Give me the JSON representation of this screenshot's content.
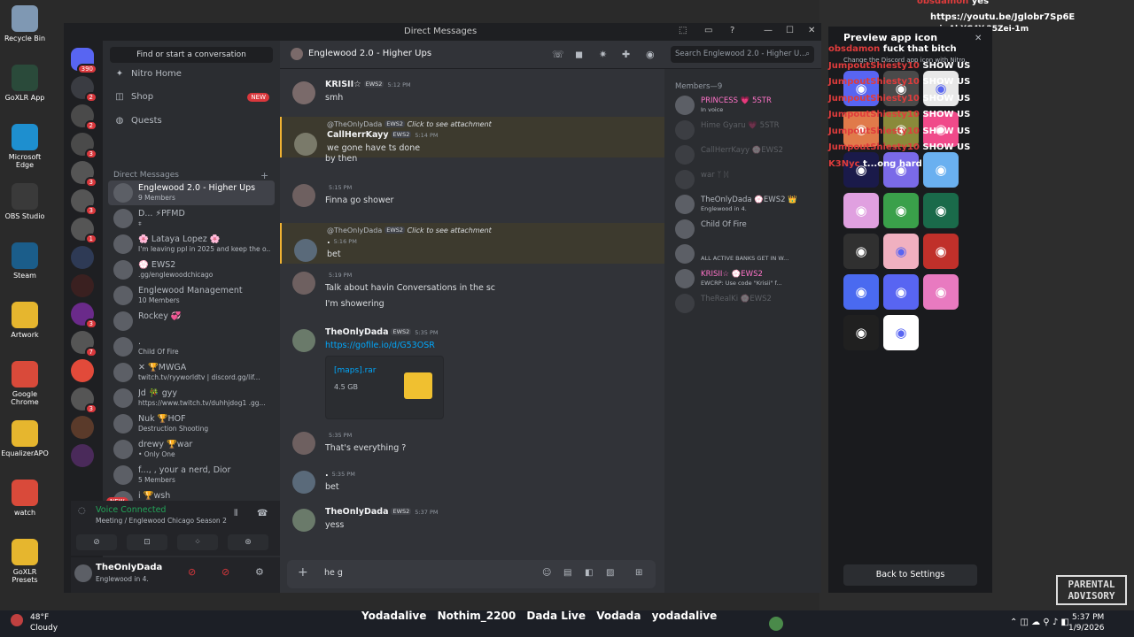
{
  "desktop": {
    "icons": [
      {
        "label": "Recycle Bin",
        "color": "#7f98b3"
      },
      {
        "label": "GoXLR App",
        "color": "#2a4a3a"
      },
      {
        "label": "Microsoft Edge",
        "color": "#1e8fcf"
      },
      {
        "label": "OBS Studio",
        "color": "#3a3a3a"
      },
      {
        "label": "Steam",
        "color": "#1b5d8a"
      },
      {
        "label": "Artwork",
        "color": "#e6b62e"
      },
      {
        "label": "Google Chrome",
        "color": "#d94a3a"
      },
      {
        "label": "EqualizerAPO",
        "color": "#e6b62e"
      },
      {
        "label": "watch",
        "color": "#d94a3a"
      },
      {
        "label": "GoXLR Presets",
        "color": "#e6b62e"
      }
    ],
    "parental_advisory": "PARENTAL ADVISORY"
  },
  "window": {
    "title": "Direct Messages",
    "controls": [
      "⬚",
      "▭",
      "?",
      "—",
      "☐",
      "✕"
    ]
  },
  "guilds": [
    {
      "badge": "390",
      "color": "#5865f2"
    },
    {
      "badge": "2",
      "color": "#3a3c42"
    },
    {
      "badge": "2",
      "color": "#4a4a4a"
    },
    {
      "badge": "3",
      "color": "#4a4a4a"
    },
    {
      "badge": "3",
      "color": "#555"
    },
    {
      "badge": "3",
      "color": "#555"
    },
    {
      "badge": "1",
      "color": "#555"
    },
    {
      "badge": "",
      "color": "#2e3a55"
    },
    {
      "badge": "",
      "color": "#3a2020"
    },
    {
      "badge": "3",
      "color": "#6a2a8a"
    },
    {
      "badge": "7",
      "color": "#555"
    },
    {
      "badge": "",
      "color": "#e24a3a"
    },
    {
      "badge": "3",
      "color": "#555"
    },
    {
      "badge": "",
      "color": "#5a3a2a"
    },
    {
      "badge": "",
      "color": "#4a2a5a"
    }
  ],
  "dm_column": {
    "search_placeholder": "Find or start a conversation",
    "nav": [
      {
        "label": "Nitro Home",
        "icon": "✦"
      },
      {
        "label": "Shop",
        "icon": "◫",
        "new": "NEW"
      },
      {
        "label": "Quests",
        "icon": "◍"
      }
    ],
    "header": "Direct Messages",
    "plus": "+",
    "dms": [
      {
        "name": "Englewood 2.0 - Higher Ups",
        "sub": "9 Members",
        "selected": true
      },
      {
        "name": "D... ⚡PFMD",
        "sub": "⧧"
      },
      {
        "name": "🌸 Lataya Lopez 🌸",
        "sub": "I'm leaving ppl in 2025 and keep the o..."
      },
      {
        "name": "💮 EWS2",
        "sub": ".gg/englewoodchicago"
      },
      {
        "name": "Englewood Management",
        "sub": "10 Members"
      },
      {
        "name": "Rockey 💞",
        "sub": ""
      },
      {
        "name": ".",
        "sub": "Child Of Fire"
      },
      {
        "name": "✕ 🏆MWGA",
        "sub": "twitch.tv/ryyworldtv | discord.gg/lif..."
      },
      {
        "name": "Jd 🎋 gyy",
        "sub": "https://www.twitch.tv/duhhjdog1 .gg..."
      },
      {
        "name": "Nuk 🏆HOF",
        "sub": "Destruction Shooting"
      },
      {
        "name": "drewy 🏆war",
        "sub": "• Only One"
      },
      {
        "name": "f..., , your a nerd, Dior",
        "sub": "5 Members"
      },
      {
        "name": "i 🏆wsh",
        "sub": ""
      }
    ],
    "new_badge": "NEW"
  },
  "voice": {
    "status": "Voice Connected",
    "channel": "Meeting / Englewood Chicago Season 2",
    "buttons": [
      "⊘",
      "⊡",
      "⁘",
      "⊛"
    ]
  },
  "user": {
    "name": "TheOnlyDada",
    "status": "Englewood in 4."
  },
  "chat": {
    "channel": "Englewood 2.0 - Higher Ups",
    "search_placeholder": "Search Englewood 2.0 - Higher U...",
    "header_icons": [
      "☏",
      "◼",
      "✷",
      "✚",
      "◉"
    ],
    "messages": [
      {
        "type": "full",
        "author": "KRISII☆",
        "tag": "EWS2",
        "time": "5:12 PM",
        "text": "smh",
        "color": "#7a6a6a"
      },
      {
        "type": "reply",
        "reply_author": "@TheOnlyDada",
        "reply_tag": "EWS2",
        "reply_text": "Click to see attachment",
        "author": "CallHerrKayy",
        "tag": "EWS2",
        "time": "5:14 PM",
        "text": "we gone have ts done",
        "color": "#7a7a6a"
      },
      {
        "type": "cont",
        "text": "by then"
      },
      {
        "type": "full",
        "author": "",
        "tag": "",
        "time": "5:15 PM",
        "text": "Finna go shower",
        "color": "#6e6060"
      },
      {
        "type": "reply",
        "reply_author": "@TheOnlyDada",
        "reply_tag": "EWS2",
        "reply_text": "Click to see attachment",
        "author": ".",
        "tag": "",
        "time": "5:16 PM",
        "text": "bet",
        "color": "#5a6a7a"
      },
      {
        "type": "full",
        "author": "",
        "tag": "",
        "time": "5:19 PM",
        "text": "Talk about havin Conversations in the sc",
        "color": "#6e6060"
      },
      {
        "type": "cont",
        "text": "I'm showering"
      },
      {
        "type": "full",
        "author": "TheOnlyDada",
        "tag": "EWS2",
        "time": "5:35 PM",
        "text": "",
        "link": "https://gofile.io/d/G53OSR",
        "color": "#6a7a6a"
      },
      {
        "type": "file",
        "file_name": "[maps].rar",
        "file_size": "4.5 GB"
      },
      {
        "type": "full",
        "author": "",
        "tag": "",
        "time": "5:35 PM",
        "text": "That's everything ?",
        "color": "#6e6060"
      },
      {
        "type": "full",
        "author": ".",
        "tag": "",
        "time": "5:35 PM",
        "text": "bet",
        "color": "#5a6a7a"
      },
      {
        "type": "full",
        "author": "TheOnlyDada",
        "tag": "EWS2",
        "time": "5:37 PM",
        "text": "yess",
        "color": "#6a7a6a"
      }
    ],
    "composer_value": "he g",
    "composer_icons": [
      "☺",
      "▤",
      "◧",
      "▨",
      "⊞"
    ]
  },
  "members": {
    "header": "Members—9",
    "list": [
      {
        "name": "PRINCESS 💗 5STR",
        "sub": "In voice",
        "color": "#ff73c8",
        "online": true
      },
      {
        "name": "Hime Gyaru 💗 5STR",
        "sub": "",
        "color": "#b5bac1",
        "online": false
      },
      {
        "name": "CallHerrKayy 💮EWS2",
        "sub": "",
        "color": "#b5bac1",
        "online": false
      },
      {
        "name": "war ᛉ ᛞ",
        "sub": "",
        "color": "#b5bac1",
        "online": false
      },
      {
        "name": "TheOnlyDada 💮EWS2 👑",
        "sub": "Englewood in 4.",
        "color": "#b5bac1",
        "online": true
      },
      {
        "name": "Child Of Fire",
        "sub": "",
        "color": "#b5bac1",
        "online": true
      },
      {
        "name": "",
        "sub": "ALL ACTIVE BANKS GET IN W...",
        "color": "#b5bac1",
        "online": true
      },
      {
        "name": "KRISII☆ 💮EWS2",
        "sub": "EWCRP: Use code \"Krisii\" f...",
        "color": "#ff73c8",
        "online": true
      },
      {
        "name": "TheRealKi 💮EWS2",
        "sub": "",
        "color": "#b5bac1",
        "online": false
      }
    ]
  },
  "preview_panel": {
    "title": "Preview app icon",
    "subtitle": "Change the Discord app icon with Nitro.",
    "back": "Back to Settings",
    "tiles": [
      {
        "color": "#5865f2",
        "glyph": "◉"
      },
      {
        "color": "#4a4a4a",
        "glyph": "◉"
      },
      {
        "color": "#e8e8e8",
        "glyph": "◉"
      },
      {
        "color": "#e07a4a",
        "glyph": "◉"
      },
      {
        "color": "#8a8a3a",
        "glyph": "◉"
      },
      {
        "color": "#f04a8a",
        "glyph": "◉"
      },
      {
        "color": "#1a1a4a",
        "glyph": "◉"
      },
      {
        "color": "#7a6ae8",
        "glyph": "◉"
      },
      {
        "color": "#6ab0f0",
        "glyph": "◉"
      },
      {
        "color": "#e0a0e0",
        "glyph": "◉"
      },
      {
        "color": "#3aa04a",
        "glyph": "◉"
      },
      {
        "color": "#1a6a4a",
        "glyph": "◉"
      },
      {
        "color": "#303030",
        "glyph": "◉"
      },
      {
        "color": "#f0b0c0",
        "glyph": "◉"
      },
      {
        "color": "#c0302a",
        "glyph": "◉"
      },
      {
        "color": "#4a6af0",
        "glyph": "◉"
      },
      {
        "color": "#5865f2",
        "glyph": "◉"
      },
      {
        "color": "#e87ac0",
        "glyph": "◉"
      },
      {
        "color": "#202020",
        "glyph": "◉"
      },
      {
        "color": "#ffffff",
        "glyph": "◉"
      }
    ]
  },
  "stream_chat": {
    "top_user": "obsdamon",
    "top_msg": "yes",
    "link_line": "https://youtu.be/Jglobr7Sp6E",
    "link_line2": "si=AhYG4Y-25Zei-1m",
    "lines": [
      {
        "user": "obsdamon",
        "msg": "fuck that bitch"
      },
      {
        "user": "JumpoutShiesty10",
        "msg": "SHOW US"
      },
      {
        "user": "JumpoutShiesty10",
        "msg": "SHOW US"
      },
      {
        "user": "JumpoutShiesty10",
        "msg": "SHOW US"
      },
      {
        "user": "JumpoutShiesty10",
        "msg": "SHOW US"
      },
      {
        "user": "JumpoutShiesty10",
        "msg": "SHOW US"
      },
      {
        "user": "JumpoutShiesty10",
        "msg": "SHOW US"
      },
      {
        "user": "K3Nyc",
        "msg": "t...ong hard"
      }
    ]
  },
  "taskbar": {
    "weather_temp": "48°F",
    "weather_desc": "Cloudy",
    "time": "5:37 PM",
    "date": "1/9/2026",
    "socials": [
      "Yodadalive",
      "Nothim_2200",
      "Dada Live",
      "Vodada",
      "yodadalive"
    ]
  }
}
